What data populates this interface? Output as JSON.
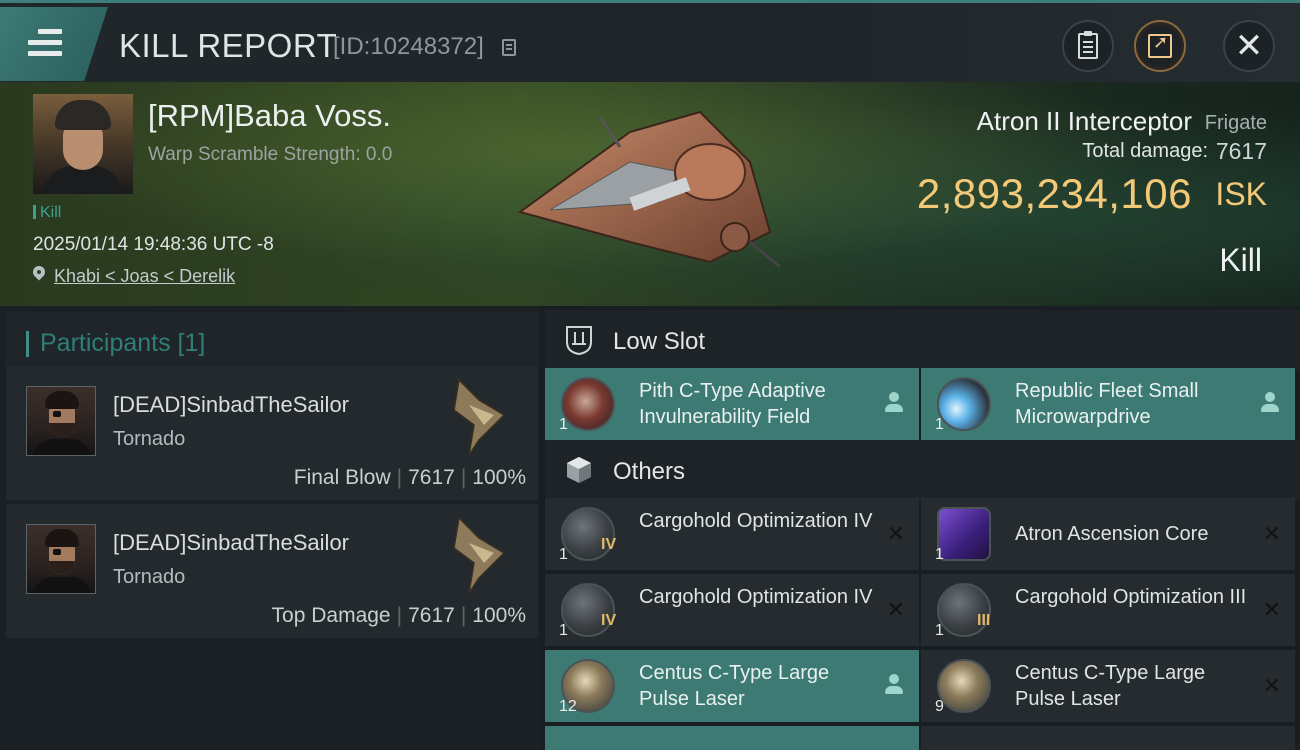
{
  "header": {
    "title": "KILL REPORT",
    "report_id": "[ID:10248372]"
  },
  "victim": {
    "name": "[RPM]Baba Voss.",
    "warp_scramble": "Warp Scramble Strength: 0.0",
    "tag": "Kill",
    "timestamp": "2025/01/14 19:48:36 UTC -8",
    "location": "Khabi < Joas < Derelik",
    "ship_name": "Atron II Interceptor",
    "ship_class": "Frigate",
    "total_damage_label": "Total damage:",
    "total_damage": "7617",
    "isk_value": "2,893,234,106",
    "isk_unit": "ISK",
    "result": "Kill"
  },
  "participants": {
    "header": "Participants [1]",
    "items": [
      {
        "name": "[DEAD]SinbadTheSailor",
        "ship": "Tornado",
        "role": "Final Blow",
        "damage": "7617",
        "percent": "100%"
      },
      {
        "name": "[DEAD]SinbadTheSailor",
        "ship": "Tornado",
        "role": "Top Damage",
        "damage": "7617",
        "percent": "100%"
      }
    ]
  },
  "sections": {
    "low_slot": "Low Slot",
    "others": "Others"
  },
  "modules": {
    "low_slot": [
      {
        "name": "Pith C-Type Adaptive Invulnerability Field",
        "qty": "1",
        "level": "",
        "status": "person-icon"
      },
      {
        "name": "Republic Fleet Small Microwarpdrive",
        "qty": "1",
        "level": "",
        "status": "person-icon"
      }
    ],
    "others": [
      {
        "name": "Cargohold Optimization IV",
        "qty": "1",
        "level": "IV",
        "status": "✕"
      },
      {
        "name": "Atron Ascension Core",
        "qty": "1",
        "level": "",
        "status": "✕"
      },
      {
        "name": "Cargohold Optimization IV",
        "qty": "1",
        "level": "IV",
        "status": "✕"
      },
      {
        "name": "Cargohold Optimization III",
        "qty": "1",
        "level": "III",
        "status": "✕"
      },
      {
        "name": "Centus C-Type Large Pulse Laser",
        "qty": "12",
        "level": "",
        "status": "person-icon"
      },
      {
        "name": "Centus C-Type Large Pulse Laser",
        "qty": "9",
        "level": "",
        "status": "✕"
      }
    ]
  },
  "colors": {
    "accent_teal": "#3d7a73",
    "isk_gold": "#f3c977",
    "background": "#1b2024"
  }
}
